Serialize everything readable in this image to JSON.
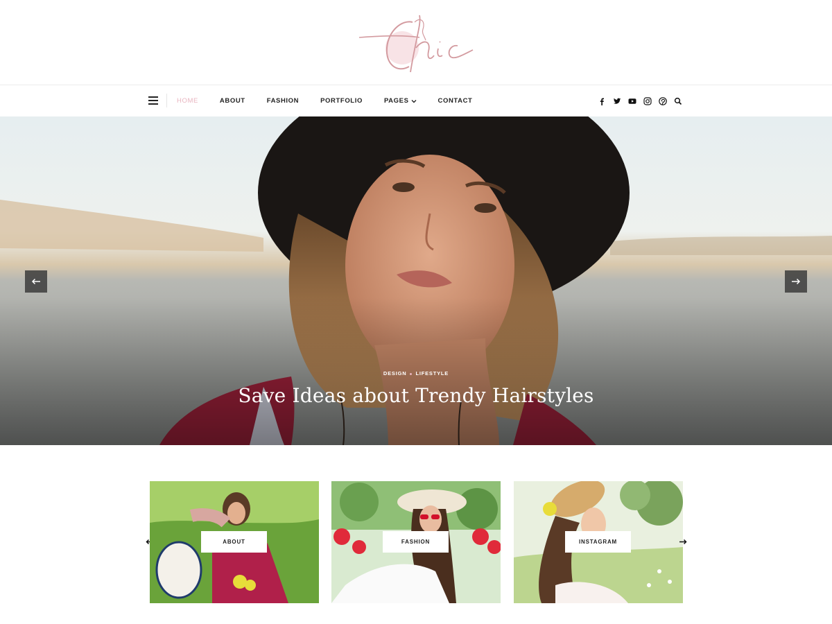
{
  "brand": {
    "logo_text": "Chic",
    "accent": "#e8b4bf",
    "logo_color": "#d39a9f"
  },
  "nav": {
    "items": [
      {
        "label": "HOME",
        "active": true
      },
      {
        "label": "ABOUT"
      },
      {
        "label": "FASHION"
      },
      {
        "label": "PORTFOLIO"
      },
      {
        "label": "PAGES",
        "has_dropdown": true
      },
      {
        "label": "CONTACT"
      }
    ],
    "social": [
      "facebook-icon",
      "twitter-icon",
      "youtube-icon",
      "instagram-icon",
      "pinterest-icon",
      "search-icon"
    ]
  },
  "hero": {
    "categories": [
      "DESIGN",
      "LIFESTYLE"
    ],
    "title": "Save Ideas about Trendy Hairstyles"
  },
  "promo": {
    "items": [
      {
        "label": "ABOUT"
      },
      {
        "label": "FASHION"
      },
      {
        "label": "INSTAGRAM"
      }
    ]
  }
}
